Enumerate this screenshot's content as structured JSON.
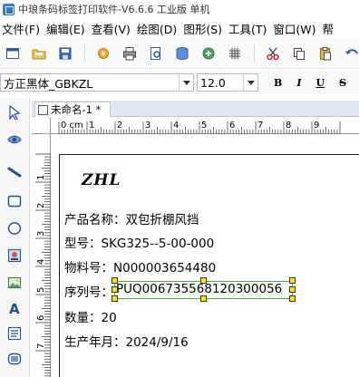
{
  "window": {
    "title": "中琅条码标签打印软件-V6.6.6 工业版 单机"
  },
  "menu": [
    "文件(F)",
    "编辑(E)",
    "查看(V)",
    "绘图(D)",
    "图形(S)",
    "工具(T)",
    "窗口(W)",
    "帮"
  ],
  "toolbar": {
    "icons": [
      "new-icon",
      "open-icon",
      "save-icon",
      "settings-icon",
      "print-icon",
      "print-preview-icon",
      "database-icon",
      "data-source-icon",
      "grid-icon",
      "cut-icon",
      "copy-icon",
      "paste-icon",
      "undo-icon"
    ]
  },
  "format_bar": {
    "font_family": "方正黑体_GBKZL",
    "font_size": "12.0",
    "bold": "B",
    "italic": "I",
    "underline": "U",
    "strike": "S"
  },
  "left_tools": [
    "select-tool-icon",
    "pan-tool-icon",
    "line-tool-icon",
    "rectangle-tool-icon",
    "ellipse-tool-icon",
    "image-tool-icon",
    "picture-tool-icon",
    "text-tool-icon",
    "rich-text-tool-icon",
    "barcode-tool-icon"
  ],
  "document": {
    "tab_title": "未命名-1 *"
  },
  "ruler": {
    "unit": "cm",
    "h_ticks": [
      "0",
      "1",
      "2",
      "3",
      "4",
      "5",
      "6",
      "7",
      "8",
      "9"
    ],
    "v_ticks": [
      "1",
      "2",
      "3",
      "4",
      "5",
      "6",
      "7"
    ]
  },
  "label": {
    "logo": "ZHL",
    "lines": {
      "product_name": "产品名称：双包折棚风挡",
      "model": "型号：SKG325--5-00-000",
      "material_no": "物料号：N000003654480",
      "serial_prefix": "序列号：",
      "serial_value": "PUQ006735568120300056",
      "quantity": "数量：20",
      "production_date": "生产年月：2024/9/16"
    }
  },
  "colors": {
    "selection_border": "#2db52d",
    "handle_fill": "#ffe600",
    "tab_strip": "#dfe8f4"
  }
}
